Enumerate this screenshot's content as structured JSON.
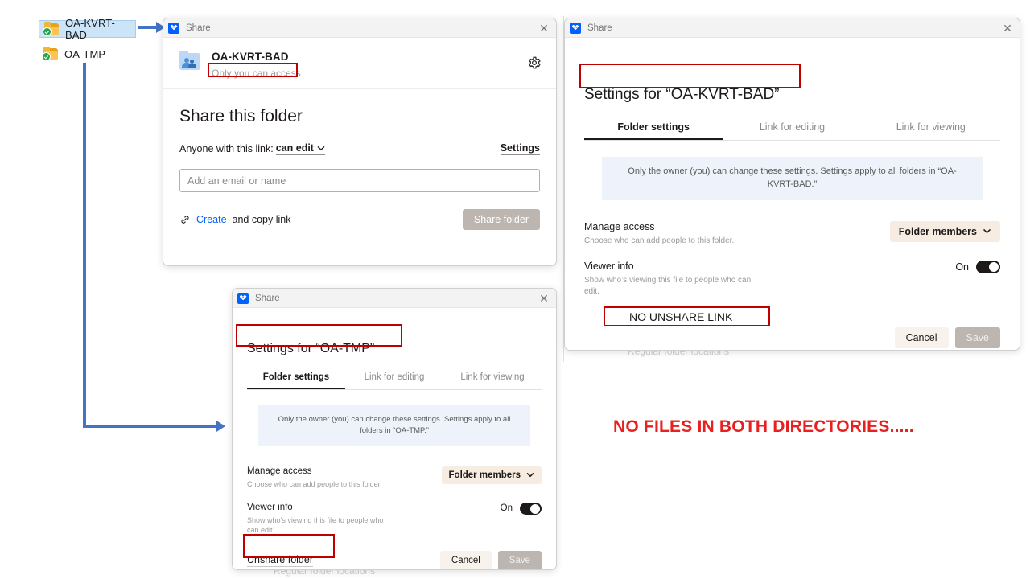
{
  "explorer": {
    "folders": [
      {
        "name": "OA-KVRT-BAD",
        "icon": "folder-synced-icon",
        "selected": true
      },
      {
        "name": "OA-TMP",
        "icon": "folder-synced-icon",
        "selected": false
      }
    ]
  },
  "share_dialog": {
    "titlebar": {
      "app": "Share",
      "close": "✕",
      "icon": "dropbox-icon"
    },
    "header": {
      "folder_name": "OA-KVRT-BAD",
      "access_status": "Only you can access",
      "gear_icon": "gear-icon",
      "folder_icon": "shared-folder-icon"
    },
    "heading": "Share this folder",
    "link_label": "Anyone with this link:",
    "link_permission": "can edit",
    "settings_link": "Settings",
    "email_placeholder": "Add an email or name",
    "email_value": "",
    "create_link_prefix": "Create",
    "create_link_suffix": "and copy link",
    "chain_icon": "link-icon",
    "share_button": "Share folder"
  },
  "settings_kvrt": {
    "titlebar": {
      "app": "Share",
      "close": "✕",
      "icon": "dropbox-icon"
    },
    "title": "Settings for “OA-KVRT-BAD”",
    "tabs": [
      {
        "label": "Folder settings",
        "active": true
      },
      {
        "label": "Link for editing",
        "active": false
      },
      {
        "label": "Link for viewing",
        "active": false
      }
    ],
    "notice": "Only the owner (you) can change these settings. Settings apply to all folders in “OA-KVRT-BAD.”",
    "manage_access": {
      "label": "Manage access",
      "description": "Choose who can add people to this folder.",
      "value": "Folder members"
    },
    "viewer_info": {
      "label": "Viewer info",
      "description": "Show who’s viewing this file to people who can edit.",
      "state": "On"
    },
    "unshare_annotation": "NO UNSHARE LINK",
    "cancel_button": "Cancel",
    "save_button": "Save"
  },
  "settings_tmp": {
    "titlebar": {
      "app": "Share",
      "close": "✕",
      "icon": "dropbox-icon"
    },
    "title": "Settings for “OA-TMP”",
    "tabs": [
      {
        "label": "Folder settings",
        "active": true
      },
      {
        "label": "Link for editing",
        "active": false
      },
      {
        "label": "Link for viewing",
        "active": false
      }
    ],
    "notice": "Only the owner (you) can change these settings. Settings apply to all folders in “OA-TMP.”",
    "manage_access": {
      "label": "Manage access",
      "description": "Choose who can add people to this folder.",
      "value": "Folder members"
    },
    "viewer_info": {
      "label": "Viewer info",
      "description": "Show who’s viewing this file to people who can edit.",
      "state": "On"
    },
    "unshare_link": "Unshare folder",
    "cancel_button": "Cancel",
    "save_button": "Save"
  },
  "annotations": {
    "no_files_note": "NO FILES IN BOTH DIRECTORIES.....",
    "arrow_color": "#4472c4",
    "highlight_color": "#c00000",
    "note_color": "#e8201f"
  }
}
